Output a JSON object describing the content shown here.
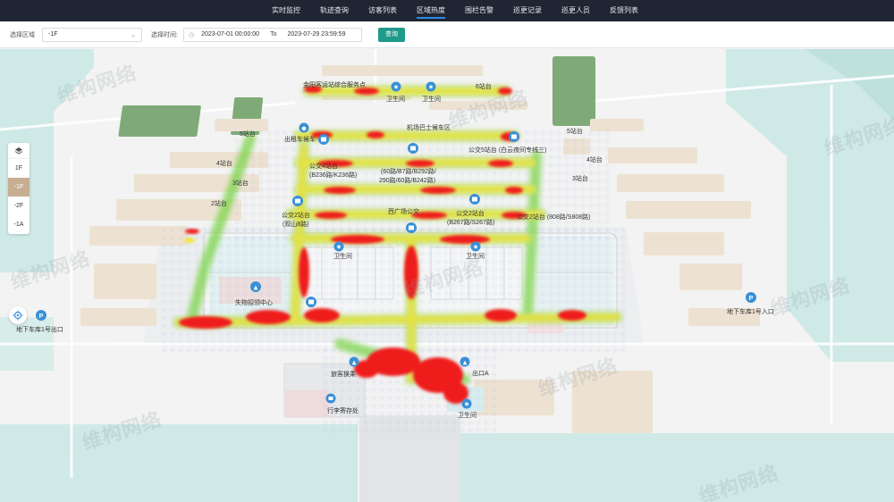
{
  "nav": {
    "tabs": [
      {
        "label": "实时监控",
        "active": false
      },
      {
        "label": "轨迹查询",
        "active": false
      },
      {
        "label": "访客列表",
        "active": false
      },
      {
        "label": "区域热度",
        "active": true
      },
      {
        "label": "围栏告警",
        "active": false
      },
      {
        "label": "巡更记录",
        "active": false
      },
      {
        "label": "巡更人员",
        "active": false
      },
      {
        "label": "反馈列表",
        "active": false
      }
    ]
  },
  "filter": {
    "area_label": "选择区域",
    "area_value": "-1F",
    "time_label": "选择时间:",
    "start": "2023-07-01 00:00:00",
    "to": "To",
    "end": "2023-07-29 23:59:59",
    "query_button": "查询"
  },
  "floors": [
    "1F",
    "-1F",
    "-2F",
    "-1A"
  ],
  "active_floor": "-1F",
  "watermark": "维构网络",
  "labels": {
    "service_point": "金阳客运站综合服务点",
    "toilet": "卫生间",
    "station6": "6站台",
    "station5": "5站台",
    "station4": "4站台",
    "station3": "3站台",
    "station2": "2站台",
    "taxi": "出租车候车",
    "airport_bus": "机场巴士候车区",
    "bus5": "公交5站台 (白云夜间专线三)",
    "bus4": "公交4站台",
    "bus4_routes": "(B236路/K236路)",
    "bus3_routes": "(60路/B7路/B292路/",
    "bus3_routes2": "290路/60路/B242路)",
    "bus2": "公交2站台",
    "bus2_guanshan": "(观山8路)",
    "west_plaza": "西广场公交",
    "bus2_mid": "公交2站台",
    "bus2_mid_routes": "(B267路/S267路)",
    "bus2_right": "公交2站台 (808路/S808路)",
    "lost_found": "失物招领中心",
    "parking_left": "地下车库1号出口",
    "parking_right": "地下车库1号入口",
    "passenger_exit": "旅客换乘",
    "exit_a": "出口A",
    "luggage": "行李寄存处"
  },
  "colors": {
    "nav_bg": "#1f2532",
    "accent": "#1e9a8a",
    "active_floor": "#c8ae90",
    "marker": "#3b8fd6",
    "green_area": "#7faa78",
    "water": "#cfe9e6"
  }
}
